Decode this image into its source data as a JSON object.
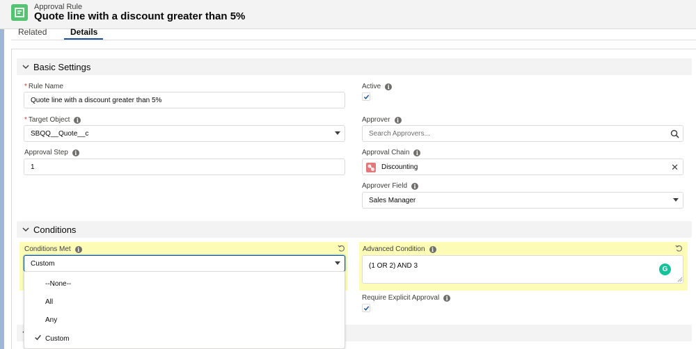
{
  "header": {
    "object_type": "Approval Rule",
    "title": "Quote line with a discount greater than 5%"
  },
  "tabs": [
    {
      "label": "Related",
      "active": false
    },
    {
      "label": "Details",
      "active": true
    }
  ],
  "sections": {
    "basic": {
      "label": "Basic Settings"
    },
    "conditions": {
      "label": "Conditions"
    }
  },
  "fields": {
    "rule_name": {
      "label": "Rule Name",
      "value": "Quote line with a discount greater than 5%"
    },
    "target_object": {
      "label": "Target Object",
      "value": "SBQQ__Quote__c"
    },
    "approval_step": {
      "label": "Approval Step",
      "value": "1"
    },
    "active": {
      "label": "Active",
      "checked": true
    },
    "approver": {
      "label": "Approver",
      "placeholder": "Search Approvers..."
    },
    "approval_chain": {
      "label": "Approval Chain",
      "value": "Discounting"
    },
    "approver_field": {
      "label": "Approver Field",
      "value": "Sales Manager"
    },
    "conditions_met": {
      "label": "Conditions Met",
      "value": "Custom"
    },
    "advanced_condition": {
      "label": "Advanced Condition",
      "value": "(1 OR 2) AND 3"
    },
    "require_explicit": {
      "label": "Require Explicit Approval",
      "checked": true
    }
  },
  "dropdown": {
    "options": [
      "--None--",
      "All",
      "Any",
      "Custom"
    ],
    "selected": "Custom"
  },
  "colors": {
    "highlight": "#fcfcb6",
    "brand_blue": "#1b5297",
    "icon_green": "#54c473",
    "chain_icon": "#e4777a"
  }
}
